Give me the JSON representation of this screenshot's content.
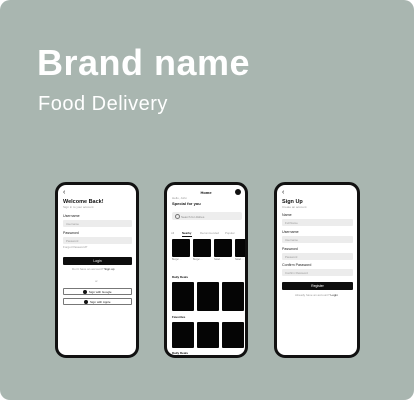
{
  "header": {
    "brand": "Brand name",
    "subtitle": "Food Delivery"
  },
  "login": {
    "back_icon": "back-arrow-icon",
    "title": "Welcome Back!",
    "caption": "Sign in to your account",
    "username_label": "Username",
    "username_placeholder": "Username",
    "password_label": "Password",
    "password_placeholder": "Password",
    "forgot": "Forgot Password?",
    "login_button": "Login",
    "no_account": "Don't have an account?",
    "signup_link": "Sign up",
    "or": "or",
    "google_button": "Sign with Google",
    "apple_button": "Sign with Apple"
  },
  "home": {
    "title": "Home",
    "greeting_caption": "Hello, John",
    "heading": "Special for you",
    "search_placeholder": "Search for dishes",
    "tabs": [
      "All",
      "Nearby",
      "Recommended",
      "Popular"
    ],
    "active_tab": 1,
    "item_captions": [
      "Burger ...",
      "Burger ...",
      "Salad ...",
      "Salad ..."
    ],
    "section_1": "Daily Deals",
    "section_2": "Favorites",
    "section_3": "Daily Deals"
  },
  "signup": {
    "title": "Sign Up",
    "caption": "Create an account",
    "name_label": "Name",
    "name_placeholder": "Full Name",
    "username_label": "Username",
    "username_placeholder": "Username",
    "password_label": "Password",
    "password_placeholder": "Password",
    "confirm_label": "Confirm Password",
    "confirm_placeholder": "Confirm Password",
    "register_button": "Register",
    "have_account": "Already have an account?",
    "login_link": "Login"
  }
}
